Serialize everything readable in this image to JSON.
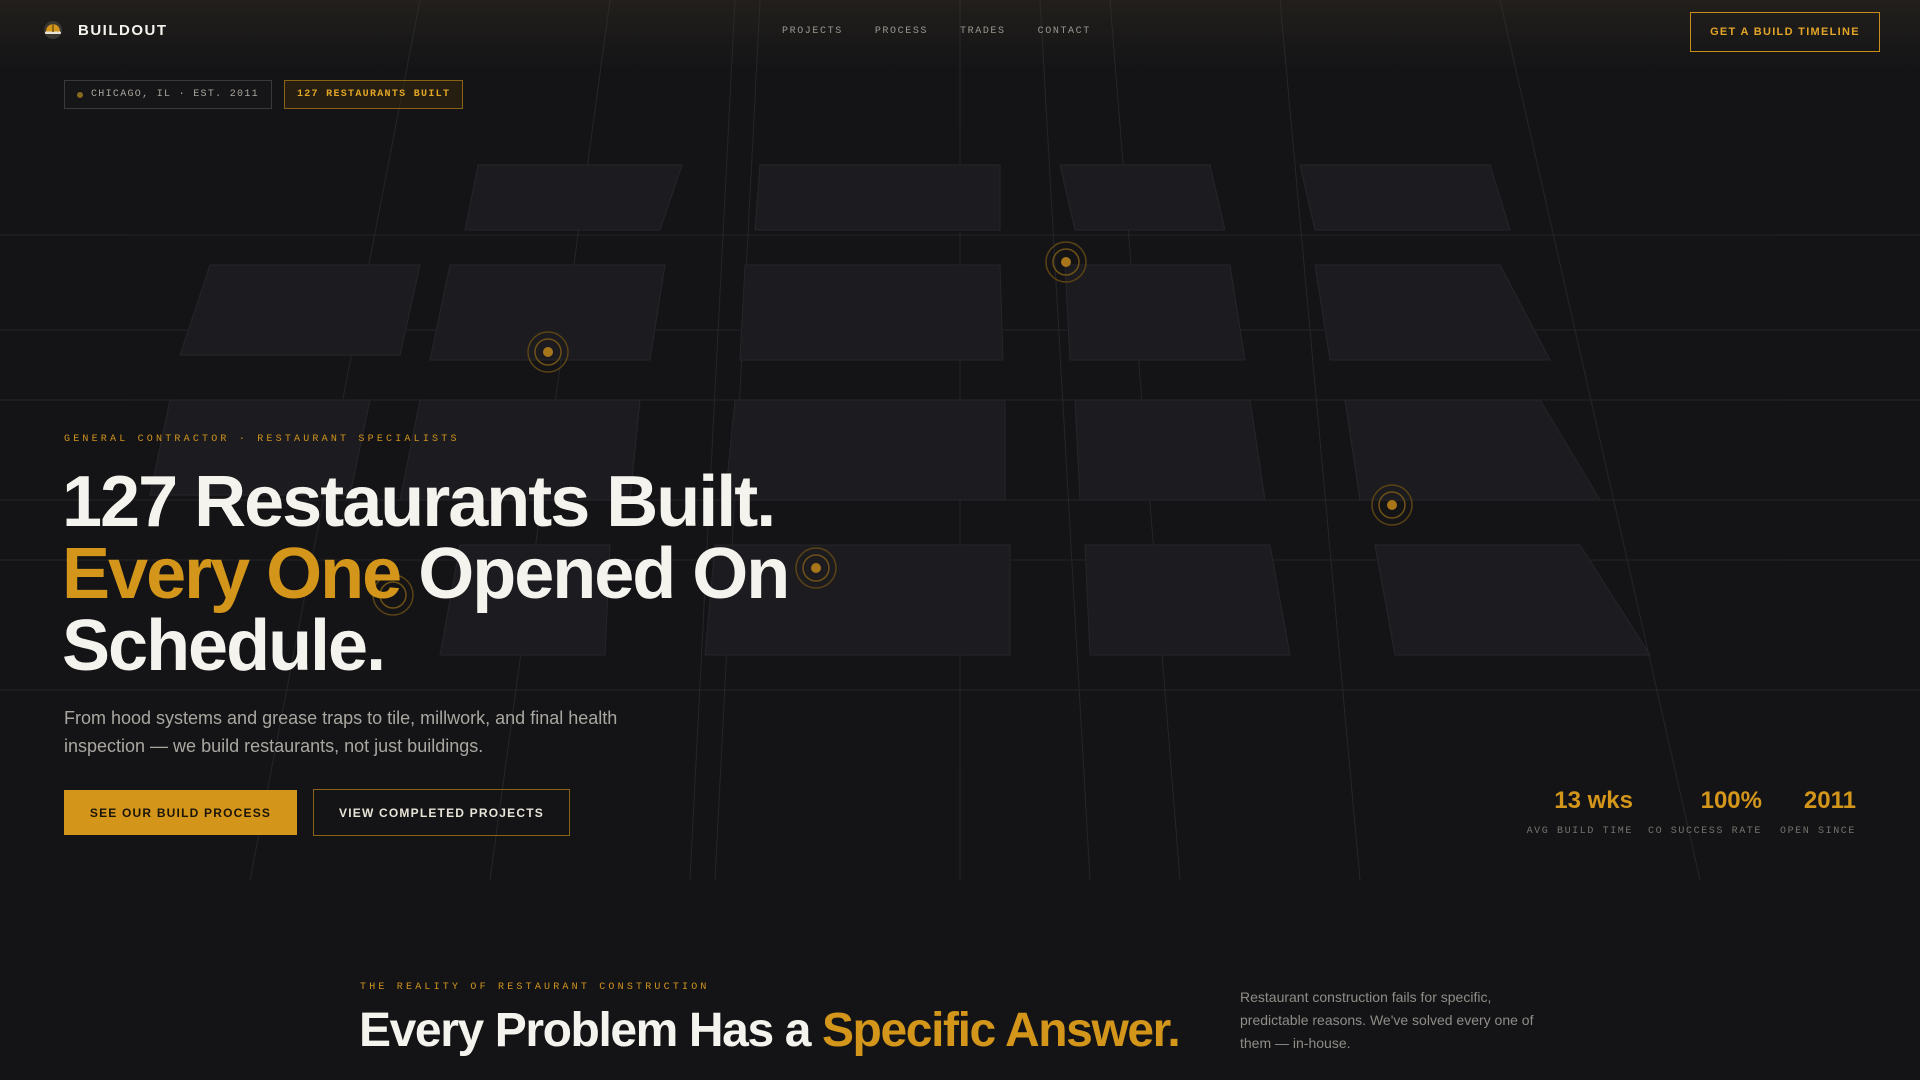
{
  "nav": {
    "brand": "BUILDOUT",
    "links": [
      "PROJECTS",
      "PROCESS",
      "TRADES",
      "CONTACT"
    ],
    "cta": "GET A BUILD TIMELINE"
  },
  "badges": {
    "location": "CHICAGO, IL · EST. 2011",
    "count": "127 RESTAURANTS BUILT"
  },
  "hero": {
    "eyebrow": "GENERAL CONTRACTOR · RESTAURANT SPECIALISTS",
    "headline_line1": "127 Restaurants Built.",
    "headline_accent": "Every One",
    "headline_line2_rest": " Opened On",
    "headline_line3": "Schedule.",
    "subhead": "From hood systems and grease traps to tile, millwork, and final health inspection — we build restaurants, not just buildings.",
    "primary_cta": "SEE OUR BUILD PROCESS",
    "secondary_cta": "VIEW COMPLETED PROJECTS"
  },
  "stats": [
    {
      "value": "13 wks",
      "label": "AVG BUILD TIME"
    },
    {
      "value": "100%",
      "label": "CO SUCCESS RATE"
    },
    {
      "value": "2011",
      "label": "OPEN SINCE"
    }
  ],
  "section2": {
    "eyebrow": "THE REALITY OF RESTAURANT CONSTRUCTION",
    "title_start": "Every Problem Has a ",
    "title_accent": "Specific Answer.",
    "description": "Restaurant construction fails for specific, predictable reasons. We've solved every one of them — in-house."
  },
  "colors": {
    "background": "#141417",
    "accent": "#d4961a",
    "text": "#f5f3ee"
  },
  "icons": {
    "brand": "hard-hat-logo-icon",
    "badge": "status-dot-icon",
    "markers": "location-pin-marker-icon"
  }
}
